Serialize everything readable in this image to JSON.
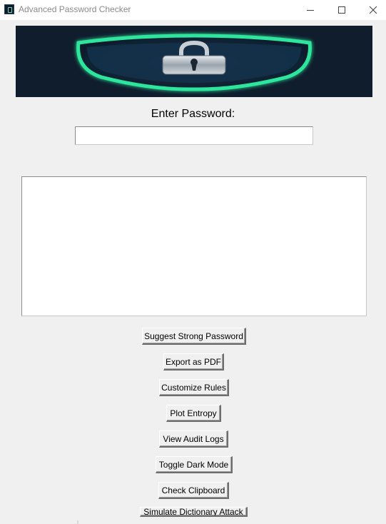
{
  "window": {
    "title": "Advanced Password Checker",
    "icon": "lock-app-icon",
    "controls": [
      "minimize",
      "maximize",
      "close"
    ]
  },
  "banner": {
    "icon": "shield-padlock-logo",
    "colors": {
      "background": "#0f1d2c",
      "shield_glow": "#2ee59d",
      "lock": "#b9c2ca"
    }
  },
  "password": {
    "label": "Enter Password:",
    "value": "",
    "placeholder": ""
  },
  "result": {
    "text": ""
  },
  "buttons": {
    "suggest": "Suggest Strong Password",
    "export_pdf": "Export as PDF",
    "customize_rules": "Customize Rules",
    "plot_entropy": "Plot Entropy",
    "view_audit_logs": "View Audit Logs",
    "toggle_dark_mode": "Toggle Dark Mode",
    "check_clipboard": "Check Clipboard",
    "simulate_attack": "Simulate Dictionary Attack"
  }
}
